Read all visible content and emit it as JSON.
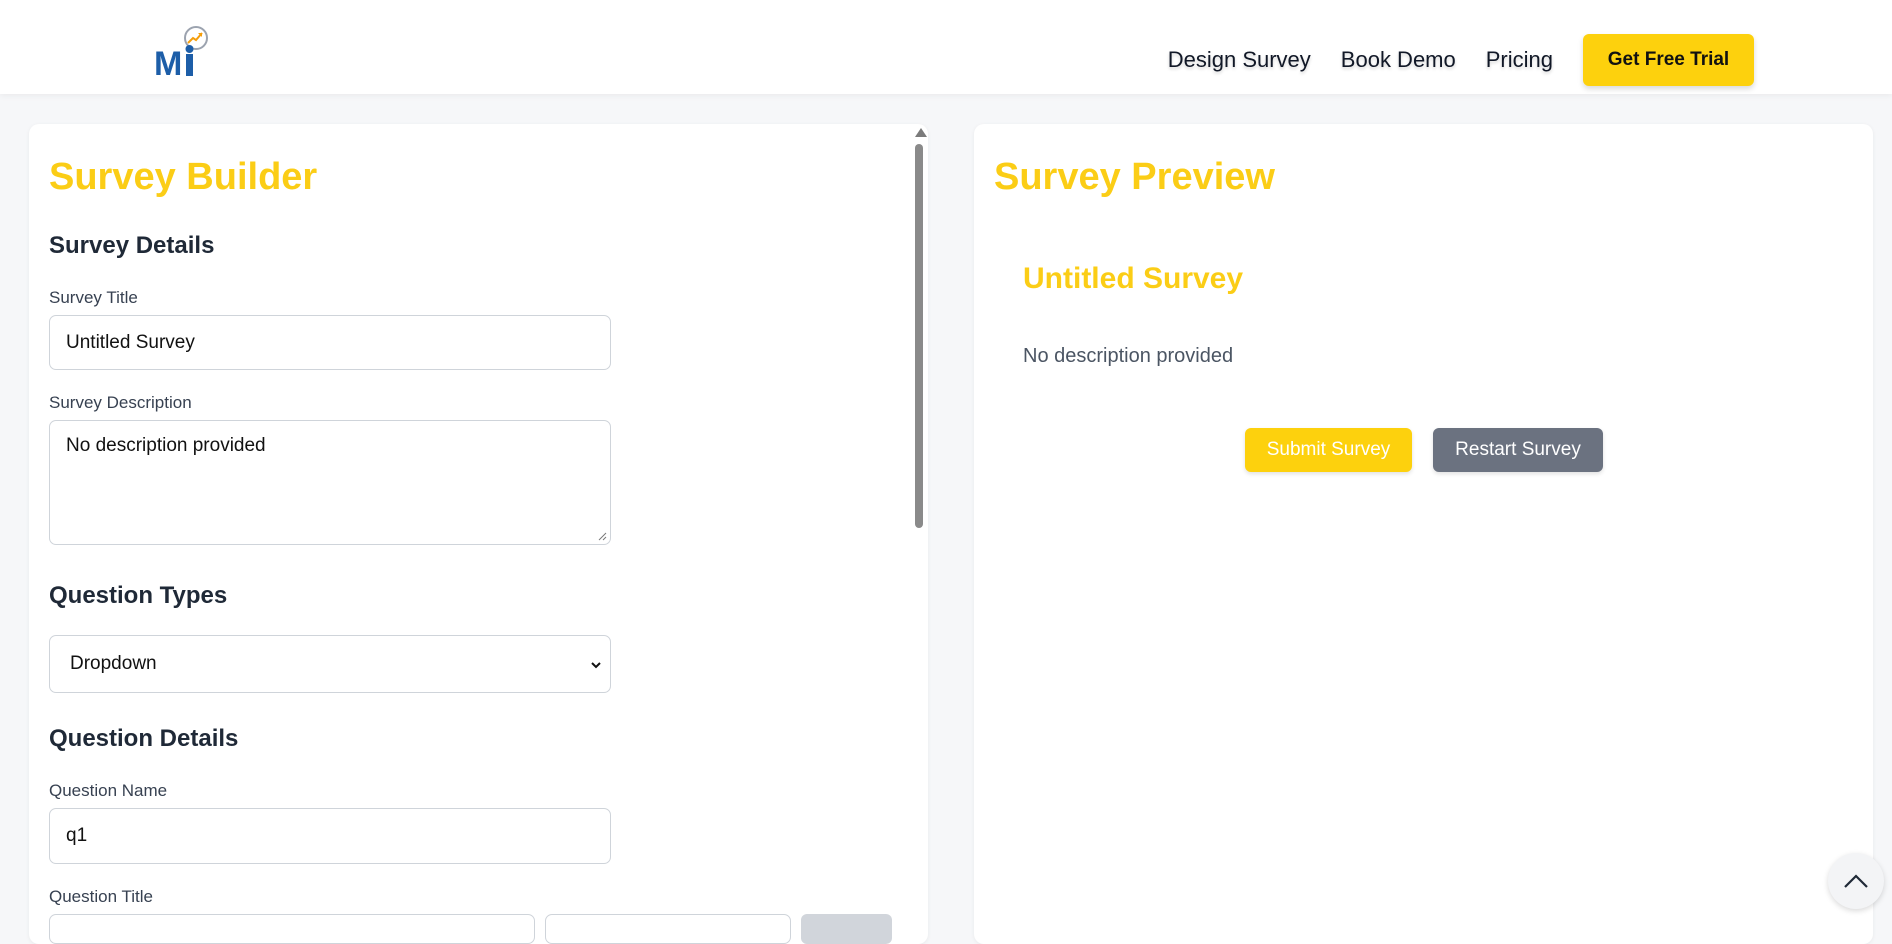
{
  "header": {
    "logo_text": "Mi",
    "nav": [
      "Design Survey",
      "Book Demo",
      "Pricing"
    ],
    "cta_label": "Get Free Trial"
  },
  "builder": {
    "title": "Survey Builder",
    "details_heading": "Survey Details",
    "survey_title_label": "Survey Title",
    "survey_title_value": "Untitled Survey",
    "survey_description_label": "Survey Description",
    "survey_description_value": "No description provided",
    "question_types_heading": "Question Types",
    "question_type_selected": "Dropdown",
    "question_details_heading": "Question Details",
    "question_name_label": "Question Name",
    "question_name_value": "q1",
    "question_title_label": "Question Title"
  },
  "preview": {
    "title": "Survey Preview",
    "survey_title": "Untitled Survey",
    "survey_description": "No description provided",
    "submit_label": "Submit Survey",
    "restart_label": "Restart Survey"
  },
  "colors": {
    "accent": "#fbcd16",
    "secondary_button": "#6b7280"
  },
  "icons": {
    "logo": "mi-growth-logo",
    "select_arrow": "chevron-down-icon",
    "back_to_top": "chevron-up-icon"
  }
}
